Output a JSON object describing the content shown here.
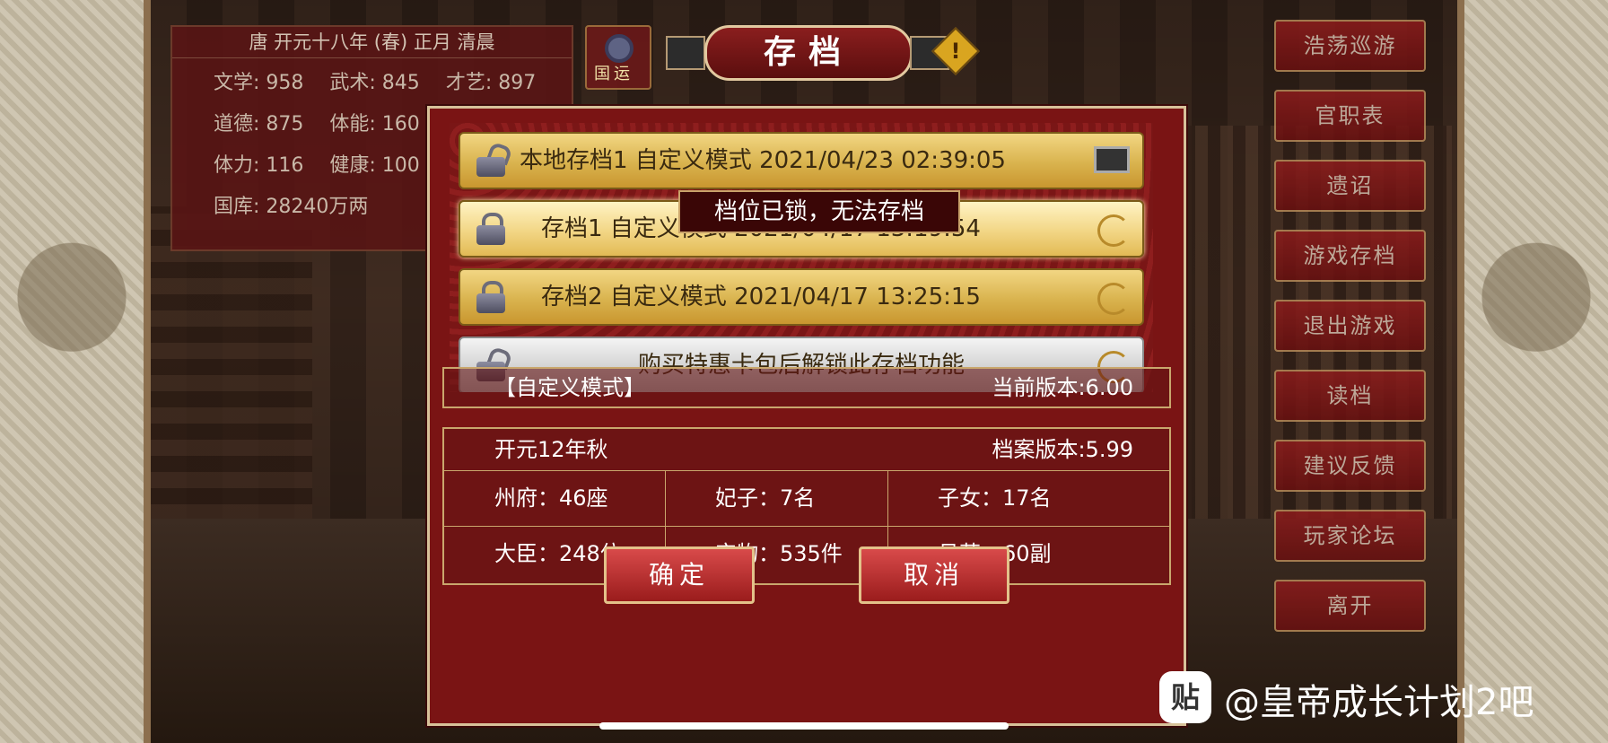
{
  "stats": {
    "header": "唐 开元十八年 (春) 正月 清晨",
    "rows": [
      [
        "文学: 958",
        "武术: 845",
        "才艺: 897"
      ],
      [
        "道德: 875",
        "体能: 160"
      ],
      [
        "体力: 116",
        "健康: 100"
      ],
      [
        "国库: 28240万两"
      ]
    ]
  },
  "search_button": {
    "label": "国运"
  },
  "title": "存档",
  "warning_icon": "!",
  "menu": [
    "浩荡巡游",
    "官职表",
    "遗诏",
    "游戏存档",
    "退出游戏",
    "读档",
    "建议反馈",
    "玩家论坛",
    "离开"
  ],
  "save_slots": [
    {
      "label": "本地存档1  自定义模式  2021/04/23 02:39:05",
      "icon": "lock-open-icon",
      "end": "computer-icon"
    },
    {
      "label": "存档1  自定义模式  2021/04/17 13:19:54",
      "icon": "lock-icon",
      "end": "cloud-icon"
    },
    {
      "label": "存档2  自定义模式  2021/04/17 13:25:15",
      "icon": "lock-icon",
      "end": "cloud-icon"
    },
    {
      "label": "购买特惠卡包后解锁此存档功能",
      "icon": "lock-open-icon",
      "end": "cloud-icon"
    }
  ],
  "tooltip": "档位已锁，无法存档",
  "details": {
    "mode": "【自定义模式】",
    "current_version": "当前版本:6.00",
    "period": "开元12年秋",
    "save_version": "档案版本:5.99",
    "grid": [
      [
        "州府：46座",
        "妃子：7名",
        "子女：17名"
      ],
      [
        "大臣：248位",
        "宝物：535件",
        "丹药：60副"
      ]
    ]
  },
  "buttons": {
    "confirm": "确定",
    "cancel": "取消"
  },
  "watermark": {
    "logo": "贴",
    "text": "@皇帝成长计划2吧"
  }
}
